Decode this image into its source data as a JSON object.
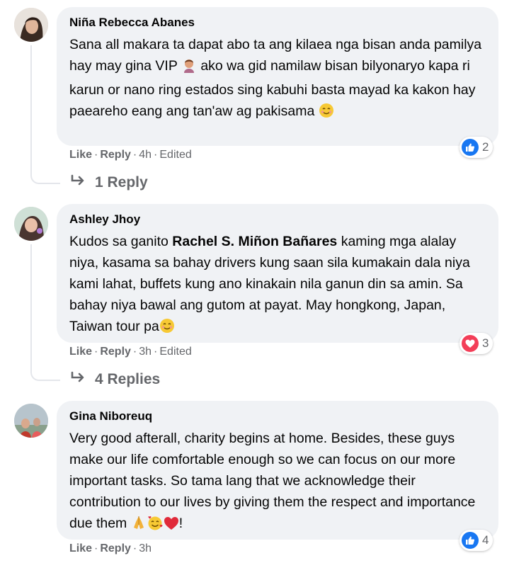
{
  "comments": [
    {
      "author": "Niña Rebecca Abanes",
      "text_part1": "Sana all makara ta dapat abo ta ang kilaea nga bisan anda pamilya hay may gina VIP",
      "text_part2": "ako wa gid namilaw bisan bilyonaryo kapa ri karun or nano ring estados sing kabuhi basta mayad ka kakon hay paeareho eang ang tan'aw ag pakisama",
      "like_label": "Like",
      "reply_label": "Reply",
      "time": "4h",
      "edited": "Edited",
      "reaction_type": "like-icon",
      "reaction_count": "2",
      "replies_label": "1 Reply"
    },
    {
      "author": "Ashley Jhoy",
      "text_part1": "Kudos sa ganito",
      "mention": "Rachel S. Miñon Bañares",
      "text_part2": "kaming mga alalay niya, kasama sa bahay drivers kung saan sila kumakain dala niya kami lahat, buffets kung ano kinakain nila ganun din sa amin. Sa bahay niya bawal ang gutom at payat. May hongkong, Japan, Taiwan tour pa",
      "like_label": "Like",
      "reply_label": "Reply",
      "time": "3h",
      "edited": "Edited",
      "reaction_type": "heart-icon",
      "reaction_count": "3",
      "replies_label": "4 Replies"
    },
    {
      "author": "Gina Niboreuq",
      "text_part1": "Very good afterall, charity begins at home. Besides, these guys make our life comfortable enough so we can focus on our more important tasks. So tama lang that we acknowledge their contribution to our lives by giving them the respect and importance due them",
      "text_end": "!",
      "like_label": "Like",
      "reply_label": "Reply",
      "time": "3h",
      "reaction_type": "like-icon",
      "reaction_count": "4"
    }
  ],
  "colors": {
    "bubble": "#f0f2f5",
    "meta_text": "#65676b",
    "like_blue": "#1877f2",
    "love_red": "#f33e58"
  }
}
